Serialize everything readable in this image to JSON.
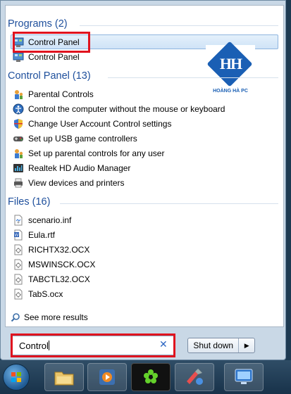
{
  "sections": {
    "programs": {
      "title": "Programs (2)",
      "items": [
        {
          "label": "Control Panel",
          "icon": "control-panel-icon"
        },
        {
          "label": "Control Panel",
          "icon": "control-panel-icon"
        }
      ]
    },
    "control_panel": {
      "title": "Control Panel (13)",
      "items": [
        {
          "label": "Parental Controls",
          "icon": "parental-controls-icon"
        },
        {
          "label": "Control the computer without the mouse or keyboard",
          "icon": "ease-of-access-icon"
        },
        {
          "label": "Change User Account Control settings",
          "icon": "uac-shield-icon"
        },
        {
          "label": "Set up USB game controllers",
          "icon": "game-controller-icon"
        },
        {
          "label": "Set up parental controls for any user",
          "icon": "parental-controls-icon"
        },
        {
          "label": "Realtek HD Audio Manager",
          "icon": "audio-manager-icon"
        },
        {
          "label": "View devices and printers",
          "icon": "devices-printers-icon"
        }
      ]
    },
    "files": {
      "title": "Files (16)",
      "items": [
        {
          "label": "scenario.inf",
          "icon": "inf-file-icon"
        },
        {
          "label": "Eula.rtf",
          "icon": "rtf-file-icon"
        },
        {
          "label": "RICHTX32.OCX",
          "icon": "ocx-file-icon"
        },
        {
          "label": "MSWINSCK.OCX",
          "icon": "ocx-file-icon"
        },
        {
          "label": "TABCTL32.OCX",
          "icon": "ocx-file-icon"
        },
        {
          "label": "TabS.ocx",
          "icon": "ocx-file-icon"
        }
      ]
    }
  },
  "watermark": {
    "name": "HOÀNG HÀ PC"
  },
  "see_more": "See more results",
  "search": {
    "value": "Control"
  },
  "shutdown_label": "Shut down",
  "taskbar": {
    "items": [
      "start-orb",
      "file-explorer",
      "media-player",
      "green-flower-app",
      "paint-app",
      "remote-desktop"
    ]
  },
  "colors": {
    "section_title": "#1e4f9c",
    "highlight_border": "#e0131e"
  }
}
